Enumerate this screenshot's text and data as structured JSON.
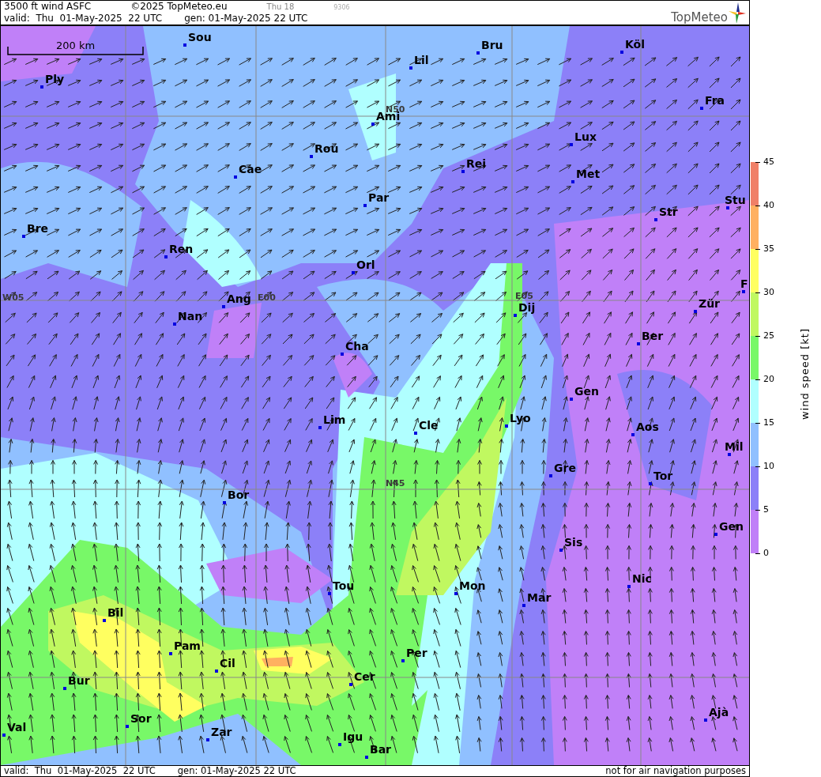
{
  "header": {
    "title": "3500 ft wind ASFC",
    "copyright": "©2025 TopMeteo.eu",
    "run_label": "Thu 18",
    "code": "9306",
    "valid": "valid:  Thu  01-May-2025  22 UTC",
    "generated": "gen: 01-May-2025 22 UTC",
    "logo": "TopMeteo"
  },
  "map": {
    "scale": "200 km",
    "grid_labels": [
      "N50",
      "W05",
      "E00",
      "E05",
      "N45"
    ],
    "cities": [
      "Sou",
      "Lil",
      "Bru",
      "Köl",
      "Ply",
      "Ami",
      "Fra",
      "Lux",
      "Rou",
      "Rei",
      "Cae",
      "Met",
      "Par",
      "Str",
      "Stu",
      "Bre",
      "Ren",
      "Orl",
      "F",
      "Ang",
      "Dij",
      "Zür",
      "Nan",
      "Ber",
      "Cha",
      "Gen",
      "Lim",
      "Cle",
      "Lyo",
      "Aos",
      "Mil",
      "Gre",
      "Tor",
      "Bor",
      "Gen",
      "Sis",
      "Nic",
      "Tou",
      "Mon",
      "Mar",
      "Bil",
      "Pam",
      "Per",
      "Cil",
      "Cer",
      "Bur",
      "Sor",
      "Ajà",
      "Zar",
      "Val",
      "Igu",
      "Bar"
    ]
  },
  "legend": {
    "title": "wind speed [kt]",
    "ticks": [
      "45",
      "40",
      "35",
      "30",
      "25",
      "20",
      "15",
      "10",
      "5",
      "0"
    ],
    "bands": [
      {
        "color": "#f08068"
      },
      {
        "color": "#ffb060"
      },
      {
        "color": "#ffff60"
      },
      {
        "color": "#c0f860"
      },
      {
        "color": "#78f868"
      },
      {
        "color": "#b0ffff"
      },
      {
        "color": "#90c0ff"
      },
      {
        "color": "#8c80f8"
      },
      {
        "color": "#c080f8"
      }
    ]
  },
  "footer": {
    "valid": "valid:  Thu  01-May-2025  22 UTC",
    "generated": "gen: 01-May-2025 22 UTC",
    "disclaimer": "not for air navigation purposes"
  }
}
